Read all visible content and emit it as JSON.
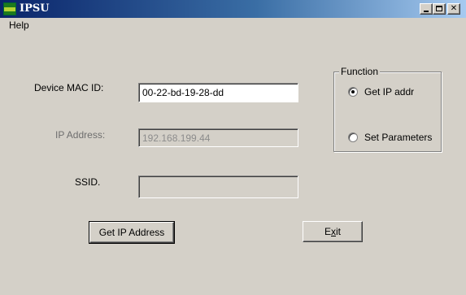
{
  "window": {
    "title": "IPSU",
    "icon": "ipsu-app-icon",
    "controls": [
      "minimize-icon",
      "maximize-icon",
      "close-icon"
    ]
  },
  "menu": {
    "help": "Help"
  },
  "form": {
    "mac_label": "Device MAC ID:",
    "mac_value": "00-22-bd-19-28-dd",
    "ip_label": "IP Address:",
    "ip_value": "192.168.199.44",
    "ssid_label": "SSID.",
    "ssid_value": ""
  },
  "function_group": {
    "legend": "Function",
    "options": [
      {
        "label": "Get IP addr",
        "selected": true
      },
      {
        "label": "Set Parameters",
        "selected": false
      }
    ]
  },
  "buttons": {
    "get_ip": "Get IP Address",
    "exit_pre": "E",
    "exit_mnemonic": "x",
    "exit_post": "it"
  },
  "colors": {
    "titlebar_start": "#0a246a",
    "titlebar_end": "#a6caf0",
    "face": "#d4d0c8"
  }
}
